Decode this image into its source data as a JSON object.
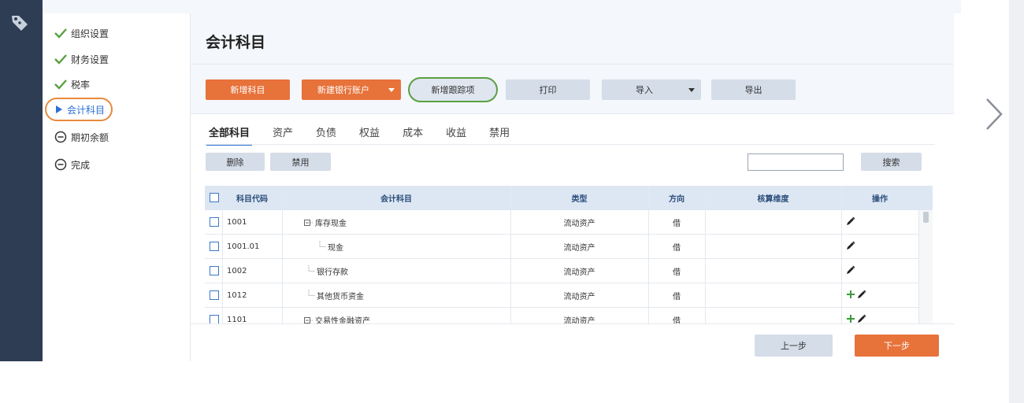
{
  "colors": {
    "sidebar_bg": "#2e3d54",
    "accent_orange": "#e7723a",
    "active_blue": "#2b6fd6",
    "check_green": "#5aa041",
    "plus_green": "#3a9b3a"
  },
  "steps": [
    {
      "label": "组织设置",
      "state": "done",
      "icon": "check-icon"
    },
    {
      "label": "财务设置",
      "state": "done",
      "icon": "check-icon"
    },
    {
      "label": "税率",
      "state": "done",
      "icon": "check-icon"
    },
    {
      "label": "会计科目",
      "state": "active",
      "icon": "play-arrow-icon"
    },
    {
      "label": "期初余额",
      "state": "pending",
      "icon": "minus-circle-icon"
    },
    {
      "label": "完成",
      "state": "pending",
      "icon": "minus-circle-icon"
    }
  ],
  "page_title": "会计科目",
  "toolbar": {
    "add_account": "新增科目",
    "new_bank_account": "新建银行账户",
    "add_tracking_item": "新增跟踪项",
    "print": "打印",
    "import": "导入",
    "export": "导出"
  },
  "tabs": [
    "全部科目",
    "资产",
    "负债",
    "权益",
    "成本",
    "收益",
    "禁用"
  ],
  "active_tab": "全部科目",
  "actions": {
    "delete": "删除",
    "disable": "禁用",
    "search": "搜索",
    "search_value": ""
  },
  "table": {
    "headers": {
      "code": "科目代码",
      "name": "会计科目",
      "type": "类型",
      "direction": "方向",
      "dimension": "核算维度",
      "operation": "操作"
    },
    "rows": [
      {
        "code": "1001",
        "name": "库存现金",
        "tree": "expand",
        "level": 0,
        "type": "流动资产",
        "direction": "借",
        "dimension": "",
        "ops": [
          "edit"
        ]
      },
      {
        "code": "1001.01",
        "name": "现金",
        "tree": "leaf",
        "level": 1,
        "type": "流动资产",
        "direction": "借",
        "dimension": "",
        "ops": [
          "edit"
        ]
      },
      {
        "code": "1002",
        "name": "银行存款",
        "tree": "leaf",
        "level": 0,
        "type": "流动资产",
        "direction": "借",
        "dimension": "",
        "ops": [
          "edit"
        ]
      },
      {
        "code": "1012",
        "name": "其他货币资金",
        "tree": "leaf",
        "level": 0,
        "type": "流动资产",
        "direction": "借",
        "dimension": "",
        "ops": [
          "add",
          "edit"
        ]
      },
      {
        "code": "1101",
        "name": "交易性金融资产",
        "tree": "expand",
        "level": 0,
        "type": "流动资产",
        "direction": "借",
        "dimension": "",
        "ops": [
          "add",
          "edit"
        ]
      }
    ]
  },
  "footer": {
    "prev": "上一步",
    "next": "下一步"
  }
}
